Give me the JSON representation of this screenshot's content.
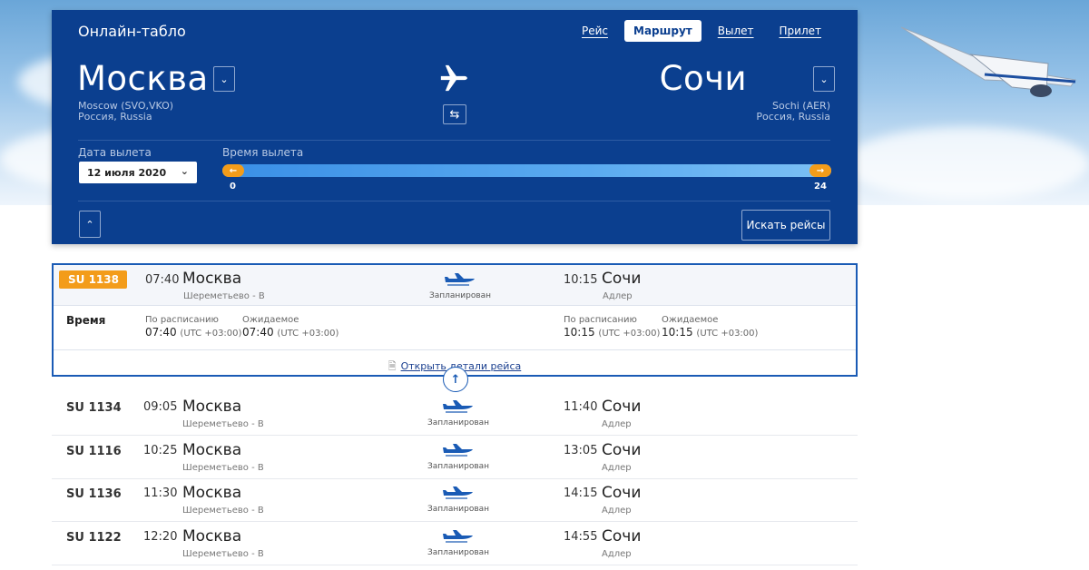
{
  "panel": {
    "title": "Онлайн-табло",
    "tabs": [
      {
        "label": "Рейс",
        "active": false
      },
      {
        "label": "Маршрут",
        "active": true
      },
      {
        "label": "Вылет",
        "active": false
      },
      {
        "label": "Прилет",
        "active": false
      }
    ],
    "from": {
      "city": "Москва",
      "code_line": "Moscow (SVO,VKO)",
      "country": "Россия, Russia"
    },
    "to": {
      "city": "Сочи",
      "code_line": "Sochi (AER)",
      "country": "Россия, Russia"
    },
    "date_label": "Дата вылета",
    "date_value": "12 июля 2020",
    "time_label": "Время вылета",
    "time_min": "0",
    "time_max": "24",
    "search_label": "Искать рейсы"
  },
  "expanded": {
    "flight": "SU 1138",
    "dep_time": "07:40",
    "dep_city": "Москва",
    "dep_airport": "Шереметьево - B",
    "status": "Запланирован",
    "arr_time": "10:15",
    "arr_city": "Сочи",
    "arr_airport": "Адлер",
    "time_label": "Время",
    "scheduled_label": "По расписанию",
    "expected_label": "Ожидаемое",
    "dep_scheduled": "07:40",
    "dep_expected": "07:40",
    "arr_scheduled": "10:15",
    "arr_expected": "10:15",
    "tz": "(UTC +03:00)",
    "details_link": "Открыть детали рейса"
  },
  "flights": [
    {
      "flight": "SU 1134",
      "dep_time": "09:05",
      "dep_city": "Москва",
      "dep_airport": "Шереметьево - B",
      "status": "Запланирован",
      "arr_time": "11:40",
      "arr_city": "Сочи",
      "arr_airport": "Адлер"
    },
    {
      "flight": "SU 1116",
      "dep_time": "10:25",
      "dep_city": "Москва",
      "dep_airport": "Шереметьево - B",
      "status": "Запланирован",
      "arr_time": "13:05",
      "arr_city": "Сочи",
      "arr_airport": "Адлер"
    },
    {
      "flight": "SU 1136",
      "dep_time": "11:30",
      "dep_city": "Москва",
      "dep_airport": "Шереметьево - B",
      "status": "Запланирован",
      "arr_time": "14:15",
      "arr_city": "Сочи",
      "arr_airport": "Адлер"
    },
    {
      "flight": "SU 1122",
      "dep_time": "12:20",
      "dep_city": "Москва",
      "dep_airport": "Шереметьево - B",
      "status": "Запланирован",
      "arr_time": "14:55",
      "arr_city": "Сочи",
      "arr_airport": "Адлер"
    }
  ],
  "colors": {
    "panel": "#0b3f8f",
    "accent": "#f39c1a",
    "link": "#1a3f8f"
  },
  "icons": {
    "plane": "airplane-icon",
    "swap": "swap-arrows-icon",
    "status": "plane-status-icon"
  }
}
